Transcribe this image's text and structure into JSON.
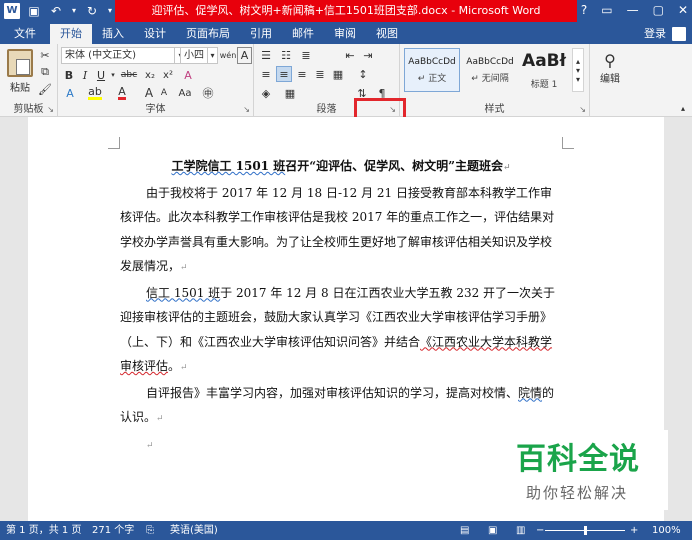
{
  "window": {
    "title": "迎评估、促学风、树文明+新闻稿+信工1501班团支部.docx - Microsoft Word",
    "buttons": [
      "?",
      "▭",
      "—",
      "▢",
      "✕"
    ]
  },
  "quick_access": {
    "word_logo": "W",
    "save_icon": "save-icon",
    "undo_icon": "undo-icon",
    "redo_icon": "redo-icon"
  },
  "tabs": [
    "文件",
    "开始",
    "插入",
    "设计",
    "页面布局",
    "引用",
    "邮件",
    "审阅",
    "视图"
  ],
  "active_tab": "开始",
  "login": "登录",
  "ribbon": {
    "clipboard": {
      "label": "剪贴板",
      "paste": "粘贴"
    },
    "font": {
      "label": "字体",
      "font_name": "宋体 (中文正文)",
      "font_size": "小四",
      "wen": "wén",
      "A_box": "A",
      "bold": "B",
      "italic": "I",
      "underline": "U",
      "strike": "abc",
      "subscript": "x₂",
      "superscript": "x²",
      "grow": "A",
      "shrink": "A",
      "case": "Aa",
      "clear": "A"
    },
    "paragraph": {
      "label": "段落"
    },
    "styles": {
      "label": "样式",
      "items": [
        {
          "sample": "AaBbCcDd",
          "name": "↵ 正文"
        },
        {
          "sample": "AaBbCcDd",
          "name": "↵ 无间隔"
        },
        {
          "sample": "AaBł",
          "name": "标题 1"
        }
      ]
    },
    "editing": {
      "label": "编辑"
    }
  },
  "document": {
    "title_part1": "工学院信工 1501 班",
    "title_part2": "召开“迎评估、促学风、树文明”主题班会",
    "p1": "由于我校将于 2017 年 12 月 18 日-12 月 21 日接受教育部本科教学工作审核评估。此次本科教学工作审核评估是我校 2017 年的重点工作之一，评估结果对学校办学声誉具有重大影响。为了让全校师生更好地了解审核评估相关知识及学校发展情况，",
    "p2_a": "信工 1501 班",
    "p2_b": "于 2017 年 12 月 8 日在江西农业大学五教 232 开了一次关于迎接审核评估的主题班会，鼓励大家认真学习《江西农业大学审核评估学习手册》（上、下）和《江西农业大学审核评估知识问答》并结合",
    "p2_c": "《江西农业大学本科教学审核评估",
    "p2_d": "。",
    "p3_a": "自评报告》丰富学习内容，加强对审核评估知识的学习，提高对校情、",
    "p3_b": "院情",
    "p3_c": "的认识。"
  },
  "watermark": {
    "title": "百科全说",
    "subtitle": "助你轻松解决"
  },
  "statusbar": {
    "page": "第 1 页，共 1 页",
    "words": "271 个字",
    "language": "英语(美国)",
    "zoom": "100%",
    "zoom_minus": "−",
    "zoom_plus": "+"
  },
  "colors": {
    "brand": "#2b579a",
    "title_highlight": "#e8000c",
    "annotation_box": "#e2262c",
    "watermark_green": "#1aa44a"
  }
}
